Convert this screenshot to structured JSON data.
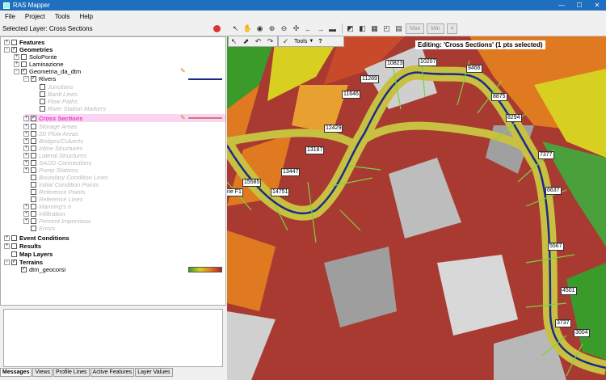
{
  "window": {
    "title": "RAS Mapper"
  },
  "menu": [
    "File",
    "Project",
    "Tools",
    "Help"
  ],
  "selected_layer": "Selected Layer: Cross Sections",
  "toolbar": {
    "tools_label": "Tools",
    "help_label": "?",
    "max_label": "Max",
    "min_label": "Min",
    "step_label": "4"
  },
  "editing_label": "Editing: 'Cross Sections' (1 pts selected)",
  "tree": {
    "features": "Features",
    "geometries": "Geometries",
    "solo_ponte": "SoloPonte",
    "laminazione": "Laminazione",
    "geometria": "Geometria_da_dtm",
    "rivers": "Rivers",
    "junctions": "Junctions",
    "bank_lines": "Bank Lines",
    "flow_paths": "Flow Paths",
    "river_stationing": "River Station Markers",
    "cross_sections": "Cross Sections",
    "storage_areas": "Storage Areas",
    "flow_areas": "2D Flow Areas",
    "bridges": "Bridges/Culverts",
    "inline": "Inline Structures",
    "lateral": "Lateral Structures",
    "sa2d": "SA/2D Connections",
    "pump": "Pump Stations",
    "bc_lines": "Boundary Condition Lines",
    "ic_points": "Initial Condition Points",
    "ref_points": "Reference Points",
    "ref_lines": "Reference Lines",
    "mannings": "Manning's n",
    "infiltration": "Infiltration",
    "impervious": "Percent Impervious",
    "errors": "Errors",
    "event_conditions": "Event Conditions",
    "results": "Results",
    "map_layers": "Map Layers",
    "terrains": "Terrains",
    "dtm": "dtm_geocorsi"
  },
  "bottom_tabs": [
    "Messages",
    "Views",
    "Profile Lines",
    "Active Features",
    "Layer Values"
  ],
  "cross_section_labels": [
    "10823",
    "10207",
    "9466",
    "11289",
    "8875",
    "11646",
    "8294",
    "12429",
    "13187",
    "7377",
    "13447",
    "15585",
    "14751",
    "ne F1",
    "6637",
    "5567",
    "4501",
    "3737",
    "3004"
  ],
  "colors": {
    "accent_title": "#1f6fbf",
    "river_line": "#1a2a8a",
    "cross_section_highlight": "#e040c0"
  }
}
